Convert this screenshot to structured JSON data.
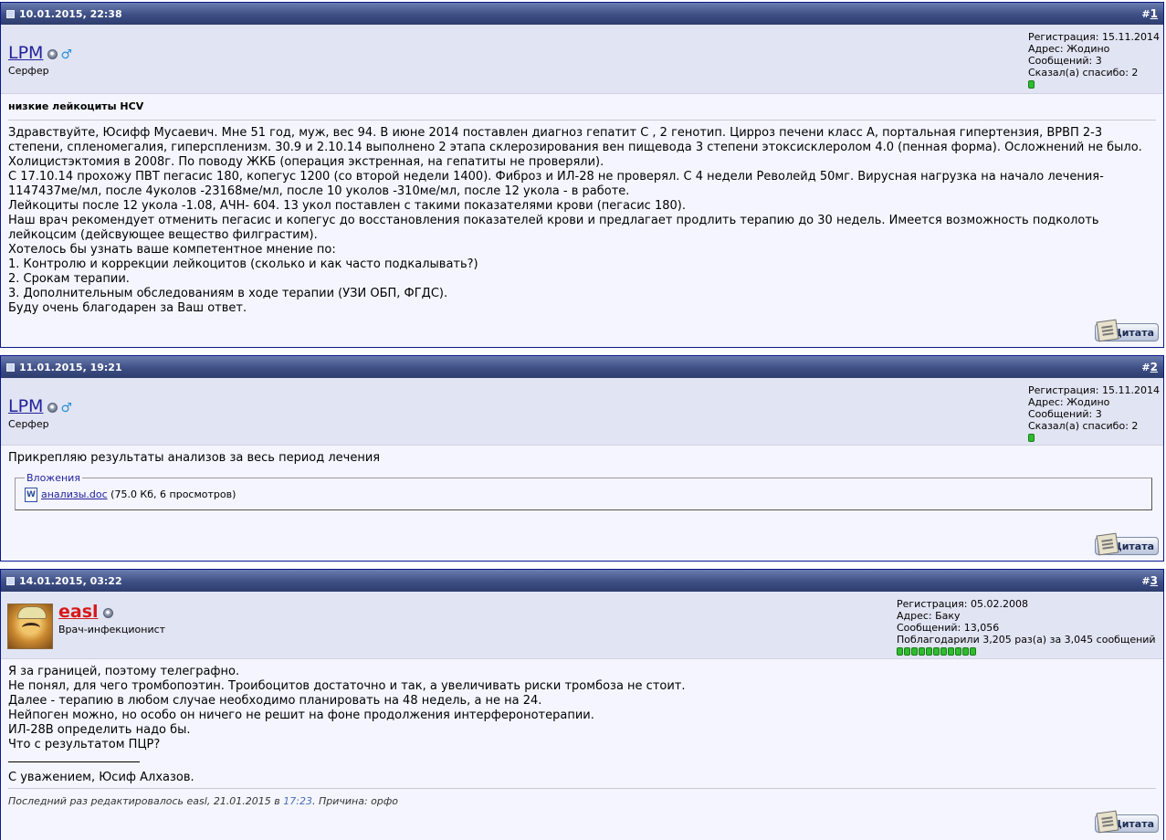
{
  "posts": [
    {
      "date": "10.01.2015, 22:38",
      "number_hash": "#",
      "number": "1",
      "user": {
        "name": "LPM",
        "title": "Серфер",
        "info": [
          "Регистрация: 15.11.2014",
          "Адрес: Жодино",
          "Сообщений: 3",
          "Сказал(а) спасибо: 2"
        ],
        "reputation_pips": 1
      },
      "title": "низкие лейкоциты HCV",
      "body": [
        "Здравствуйте, Юсифф Мусаевич. Мне 51 год, муж, вес 94. В июне 2014 поставлен диагноз гепатит С , 2 генотип. Цирроз печени класс А, портальная гипертензия, ВРВП 2-3",
        "степени, спленомегалия, гиперспленизм. 30.9 и 2.10.14 выполнено 2 этапа склерозирования вен пищевода 3 степени этоксисклеролом 4.0 (пенная форма). Осложнений не было.",
        "Холицистэктомия в 2008г. По поводу ЖКБ (операция экстренная, на гепатиты не проверяли).",
        "С 17.10.14 прохожу ПВТ пегасис 180, копегус 1200 (со второй недели 1400). Фиброз и ИЛ-28 не проверял. С 4 недели Револейд 50мг. Вирусная нагрузка на начало лечения-",
        "1147437ме/мл, после 4уколов -23168ме/мл, после 10 уколов -310ме/мл, после 12 укола - в работе.",
        "Лейкоциты после 12 укола -1.08, АЧН- 604. 13 укол поставлен с такими показателями крови (пегасис 180).",
        "Наш врач рекомендует отменить пегасис и копегус до восстановления показателей крови и предлагает продлить терапию до 30 недель. Имеется возможность подколоть",
        "лейкоцсим (дейсвующее вещество филграстим).",
        "Хотелось бы узнать ваше компетентное мнение по:",
        "1. Контролю и коррекции лейкоцитов (сколько и как часто подкалывать?)",
        "2. Срокам терапии.",
        "3. Дополнительным обследованиям в ходе терапии (УЗИ ОБП, ФГДС).",
        "Буду очень благодарен за Ваш ответ."
      ],
      "quote_label": "Цитата"
    },
    {
      "date": "11.01.2015, 19:21",
      "number_hash": "#",
      "number": "2",
      "user": {
        "name": "LPM",
        "title": "Серфер",
        "info": [
          "Регистрация: 15.11.2014",
          "Адрес: Жодино",
          "Сообщений: 3",
          "Сказал(а) спасибо: 2"
        ],
        "reputation_pips": 1
      },
      "body": [
        "Прикрепляю результаты анализов за весь период лечения"
      ],
      "attachments_legend": "Вложения",
      "attachment": {
        "name": "анализы.doc",
        "meta": "(75.0 Кб, 6 просмотров)",
        "icon_letter": "W"
      },
      "quote_label": "Цитата"
    },
    {
      "date": "14.01.2015, 03:22",
      "number_hash": "#",
      "number": "3",
      "user": {
        "name": "easl",
        "title": "Врач-инфекционист",
        "info": [
          "Регистрация: 05.02.2008",
          "Адрес: Баку",
          "Сообщений: 13,056",
          "Поблагодарили 3,205 раз(а) за 3,045 сообщений"
        ],
        "reputation_pips": 11
      },
      "body": [
        "Я за границей, поэтому телеграфно.",
        "Не понял, для чего тромбопоэтин. Троибоцитов достаточно и так, а увеличивать риски тромбоза не стоит.",
        "Далее - терапию в любом случае необходимо планировать на 48 недель, а не на 24.",
        "Нейпоген можно, но особо он ничего не решит на фоне продолжения интерферонотерапии.",
        "ИЛ-28В определить надо бы.",
        "Что с результатом ПЦР?"
      ],
      "signature": "С уважением, Юсиф Алхазов.",
      "edit_note": {
        "prefix": "Последний раз редактировалось easl, 21.01.2015 в ",
        "time": "17:23",
        "suffix": ". Причина: орфо"
      },
      "quote_label": "Цитата"
    }
  ],
  "colors": {
    "header": "#3e4f85",
    "userbar": "#e1e4f2",
    "post_bg": "#f5f5ff",
    "link": "#22229c",
    "mod_name": "#d61a1a",
    "rep": "#2dbd2d"
  }
}
